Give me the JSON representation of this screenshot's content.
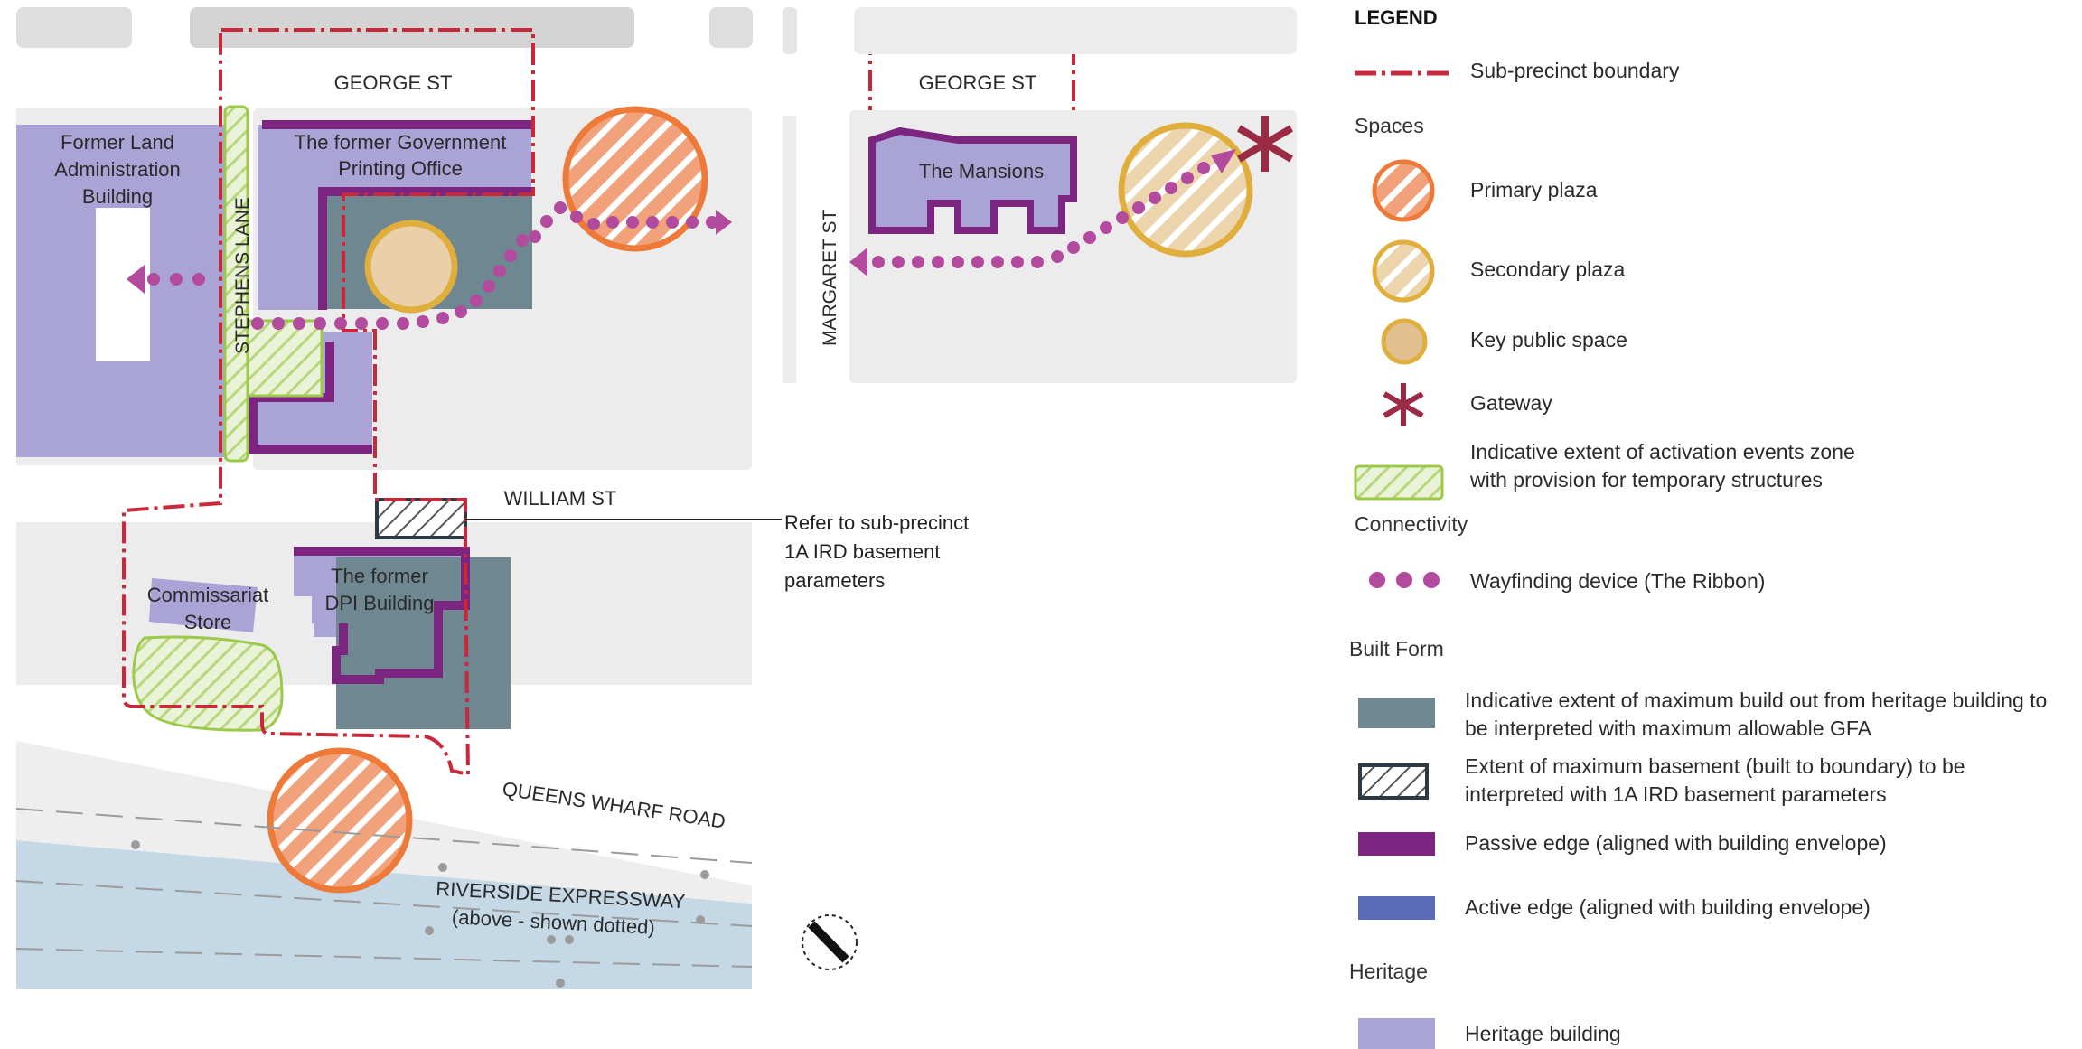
{
  "map": {
    "streets": {
      "george_st_left": "GEORGE ST",
      "george_st_right": "GEORGE ST",
      "stephens_lane": "STEPHENS  LANE",
      "margaret_st": "MARGARET ST",
      "william_st": "WILLIAM ST",
      "queens_wharf_road": "QUEENS WHARF ROAD",
      "riverside_line1": "RIVERSIDE EXPRESSWAY",
      "riverside_line2": "(above - shown dotted)"
    },
    "buildings": {
      "former_land_admin": [
        "Former Land",
        "Administration",
        "Building"
      ],
      "gov_printing_office": [
        "The former Government",
        "Printing Office"
      ],
      "mansions": "The Mansions",
      "dpi_building": [
        "The former",
        "DPI Building"
      ],
      "commissariat_store": [
        "Commissariat",
        "Store"
      ]
    },
    "callout": [
      "Refer to sub-precinct",
      "1A IRD basement",
      "parameters"
    ]
  },
  "legend": {
    "title": "LEGEND",
    "boundary_label": "Sub-precinct boundary",
    "spaces_heading": "Spaces",
    "primary_plaza": "Primary plaza",
    "secondary_plaza": "Secondary plaza",
    "key_public_space": "Key public space",
    "gateway": "Gateway",
    "activation_line1": "Indicative extent of activation events zone",
    "activation_line2": "with provision for temporary structures",
    "connectivity_heading": "Connectivity",
    "wayfinding": "Wayfinding device (The Ribbon)",
    "built_form_heading": "Built Form",
    "max_buildout_line1": "Indicative extent of maximum  build out from heritage building to",
    "max_buildout_line2": "be interpreted with maximum allowable GFA",
    "basement_line1": "Extent of maximum basement (built to boundary) to be",
    "basement_line2": "interpreted with 1A IRD basement parameters",
    "passive_edge": "Passive edge (aligned with building envelope)",
    "active_edge": "Active edge (aligned with building envelope)",
    "heritage_heading": "Heritage",
    "heritage_building": "Heritage building"
  },
  "colors": {
    "boundary": "#c8283a",
    "primary_plaza": "#ee7a3a",
    "secondary_plaza": "#e0ae3c",
    "key_public_space": "#d9b98a",
    "gateway": "#9b2a44",
    "activation": "#9cc94a",
    "ribbon": "#b24a9e",
    "max_buildout": "#6f8790",
    "passive_edge": "#7b2580",
    "active_edge": "#5a6bb8",
    "heritage": "#aaa4d6",
    "river": "#c5d8e6"
  }
}
